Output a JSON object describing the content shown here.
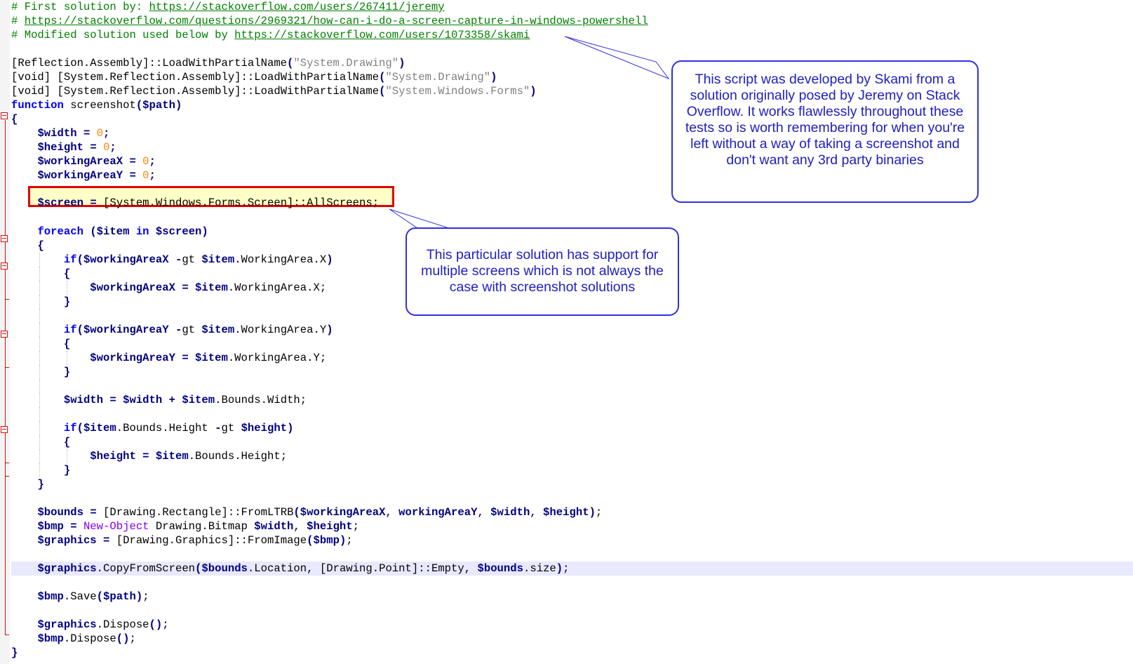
{
  "editor": {
    "comments": {
      "line1_prefix": "# First solution by: ",
      "line1_url": "https://stackoverflow.com/users/267411/jeremy",
      "line2_prefix": "# ",
      "line2_url": "https://stackoverflow.com/questions/2969321/how-can-i-do-a-screen-capture-in-windows-powershell",
      "line3_prefix": "# Modified solution used below by ",
      "line3_url": "https://stackoverflow.com/users/1073358/skami"
    },
    "tokens": {
      "reflection_assembly": "[Reflection.Assembly]",
      "void": "[void]",
      "system_reflection_assembly": "[System.Reflection.Assembly]",
      "load_partial": "::LoadWithPartialName",
      "str_drawing": "\"System.Drawing\"",
      "str_forms": "\"System.Windows.Forms\"",
      "function_kw": "function",
      "function_name": "screenshot",
      "path_var": "$path",
      "width_var": "$width",
      "height_var": "$height",
      "wax_var": "$workingAreaX",
      "way_var": "$workingAreaY",
      "zero": "0",
      "screen_var": "$screen",
      "screen_type": "[System.Windows.Forms.Screen]",
      "all_screens": "::AllScreens",
      "foreach_kw": "foreach",
      "item_var": "$item",
      "in_kw": "in",
      "if_kw": "if",
      "gt_op": "-gt",
      "wa_x": ".WorkingArea.X",
      "wa_y": ".WorkingArea.Y",
      "bounds_width": ".Bounds.Width",
      "bounds_height": ".Bounds.Height",
      "bounds_var": "$bounds",
      "rect_type": "[Drawing.Rectangle]",
      "from_ltrb": "::FromLTRB",
      "bmp_var": "$bmp",
      "new_object": "New-Object",
      "drawing_bitmap": "Drawing.Bitmap",
      "graphics_var": "$graphics",
      "graphics_type": "[Drawing.Graphics]",
      "from_image": "::FromImage",
      "copy_from_screen": ".CopyFromScreen",
      "location": ".Location",
      "point_type": "[Drawing.Point]",
      "empty": "::Empty",
      "size": ".size",
      "save": ".Save",
      "dispose": ".Dispose",
      "working_area_y_plain": "workingAreaY"
    }
  },
  "annotations": {
    "callout_top": "This script was developed by Skami from a solution originally posed by Jeremy on Stack Overflow. It works flawlessly throughout these tests so is worth remembering for when you're left without a way of taking a screenshot and don't want any 3rd party binaries",
    "callout_middle": "This particular solution has support for multiple screens which is not always the case with screenshot solutions"
  },
  "colors": {
    "comment": "#008000",
    "variable": "#000080",
    "keyword": "#0000ff",
    "string": "#808080",
    "number": "#ff8000",
    "cmdlet": "#8000ff",
    "highlight_border": "#e00000",
    "highlight_fill": "#ffffc8",
    "callout_border": "#3030e0",
    "callout_text": "#2020c0",
    "current_line": "#e8e8ff"
  }
}
